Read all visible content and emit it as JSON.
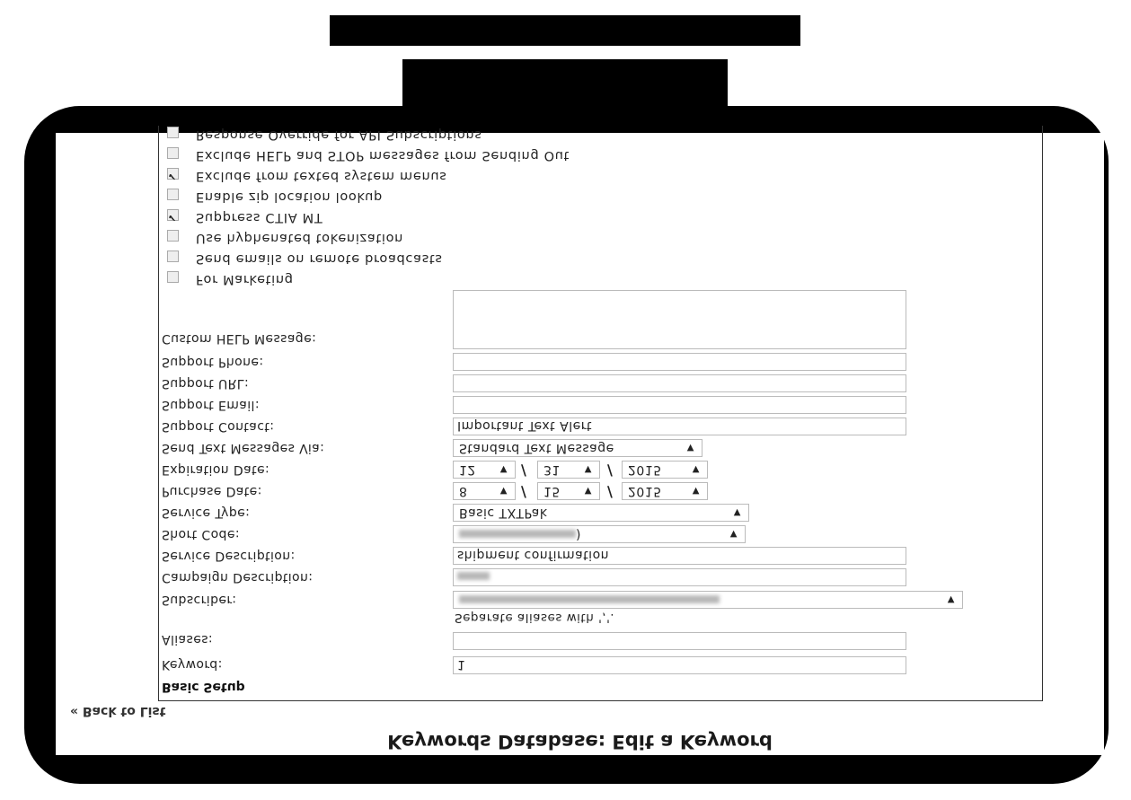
{
  "page_title": "Keywords Database: Edit a Keyword",
  "back_link": "« Back to List",
  "section_title": "Basic Setup",
  "fields": {
    "keyword": {
      "label": "Keyword:",
      "value": "1"
    },
    "aliases": {
      "label": "Aliases:",
      "value": "",
      "hint": "Separate aliases with ','."
    },
    "subscriber": {
      "label": "Subscriber:",
      "value": ""
    },
    "campaign_description": {
      "label": "Campaign Description:",
      "value": ""
    },
    "service_description": {
      "label": "Service Description:",
      "value": "shipment confirmation"
    },
    "short_code": {
      "label": "Short Code:",
      "value": ")"
    },
    "service_type": {
      "label": "Service Type:",
      "value": "Basic TXTPak"
    },
    "purchase_date": {
      "label": "Purchase Date:",
      "month": "8",
      "day": "15",
      "year": "2015"
    },
    "expiration_date": {
      "label": "Expiration Date:",
      "month": "12",
      "day": "31",
      "year": "2015"
    },
    "send_via": {
      "label": "Send Text Messages Via:",
      "value": "Standard Text Message"
    },
    "support_contact": {
      "label": "Support Contact:",
      "value": "Important Text Alert"
    },
    "support_email": {
      "label": "Support Email:",
      "value": ""
    },
    "support_url": {
      "label": "Support URL:",
      "value": ""
    },
    "support_phone": {
      "label": "Support Phone:",
      "value": ""
    },
    "custom_help": {
      "label": "Custom HELP Message:",
      "value": ""
    }
  },
  "checkboxes": [
    {
      "label": "For Marketing",
      "checked": false
    },
    {
      "label": "Send emails on remote broadcasts",
      "checked": false
    },
    {
      "label": "Use hyphenated tokenization",
      "checked": false
    },
    {
      "label": "Suppress CTIA MT",
      "checked": true
    },
    {
      "label": "Enable zip location lookup",
      "checked": false
    },
    {
      "label": "Exclude from texted system menus",
      "checked": true
    },
    {
      "label": "Exclude HELP and STOP messages from Sending Out",
      "checked": false
    },
    {
      "label": "Response Override for API Subscriptions",
      "checked": false
    }
  ],
  "separator": "/",
  "dropdown_arrow": "▼"
}
